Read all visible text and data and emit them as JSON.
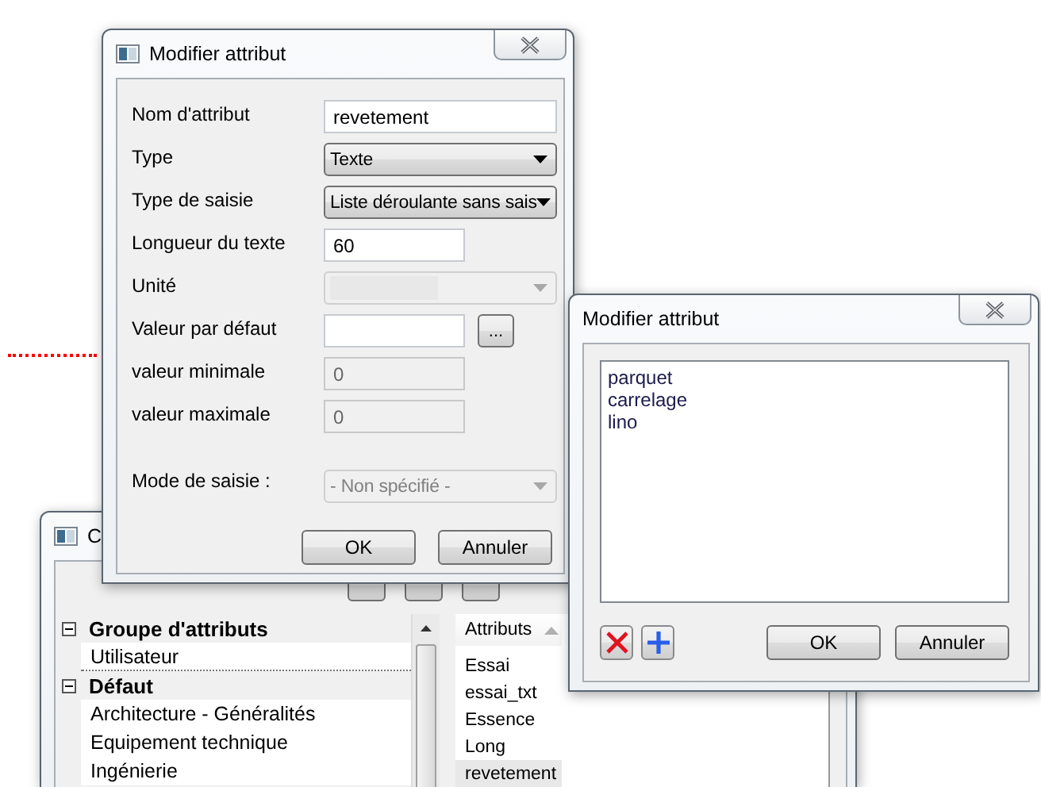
{
  "background_window": {
    "title": "C",
    "tree": [
      {
        "label": "Groupe d'attributs",
        "expanded": true,
        "children": [
          {
            "label": "Utilisateur",
            "focused": true
          }
        ]
      },
      {
        "label": "Défaut",
        "expanded": true,
        "children": [
          {
            "label": "Architecture - Généralités",
            "focused": false
          },
          {
            "label": "Equipement technique",
            "focused": false
          },
          {
            "label": "Ingénierie",
            "focused": false
          }
        ]
      }
    ],
    "list": {
      "header": "Attributs",
      "items": [
        {
          "label": "Essai",
          "selected": false
        },
        {
          "label": "essai_txt",
          "selected": false
        },
        {
          "label": "Essence",
          "selected": false
        },
        {
          "label": "Long",
          "selected": false
        },
        {
          "label": "revetement",
          "selected": true
        }
      ]
    }
  },
  "dialog_main": {
    "title": "Modifier attribut",
    "fields": [
      {
        "label": "Nom d'attribut",
        "kind": "text",
        "value": "revetement",
        "disabled": false
      },
      {
        "label": "Type",
        "kind": "combo",
        "value": "Texte",
        "disabled": false
      },
      {
        "label": "Type de saisie",
        "kind": "combo",
        "value": "Liste déroulante sans sais",
        "disabled": false
      },
      {
        "label": "Longueur du texte",
        "kind": "short-text",
        "value": "60",
        "disabled": false
      },
      {
        "label": "Unité",
        "kind": "short-combo",
        "disabled": true
      },
      {
        "label": "Valeur par défaut",
        "kind": "browse-text",
        "button": "...",
        "disabled": false
      },
      {
        "label": "valeur minimale",
        "kind": "short-text",
        "value": "0",
        "disabled": true
      },
      {
        "label": "valeur maximale",
        "kind": "short-text",
        "value": "0",
        "disabled": true
      },
      {
        "label": "Mode de saisie :",
        "kind": "combo",
        "value": "- Non spécifié -",
        "disabled": true
      }
    ],
    "buttons": [
      "OK",
      "Annuler"
    ]
  },
  "dialog_values": {
    "title": "Modifier attribut",
    "items": [
      "parquet",
      "carrelage",
      "lino"
    ],
    "buttons": [
      "OK",
      "Annuler"
    ]
  }
}
